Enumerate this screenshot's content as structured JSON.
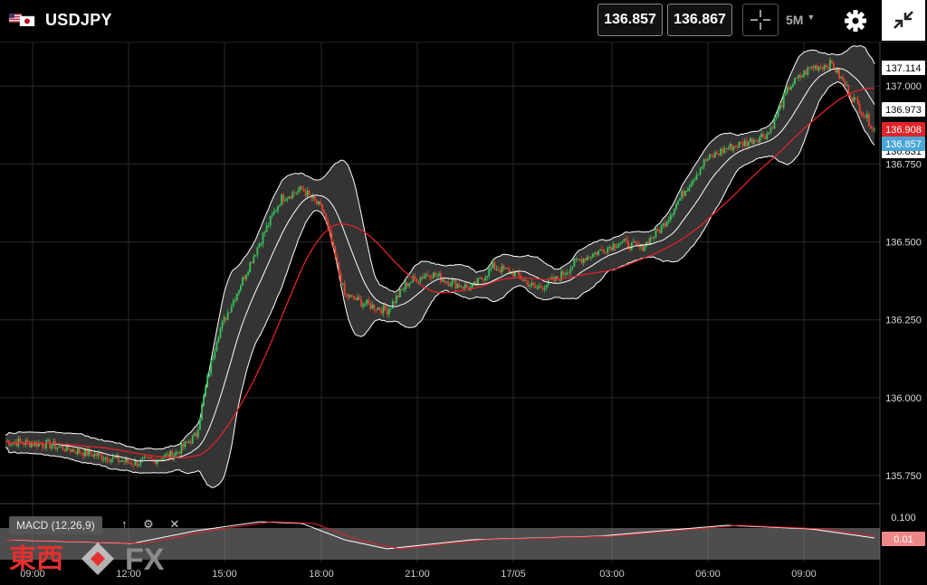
{
  "header": {
    "symbol": "USDJPY",
    "bid": "136.857",
    "ask": "136.867",
    "timeframe": "5M",
    "icons": [
      "us-jp-flags-icon",
      "crosshair-icon",
      "gear-icon",
      "collapse-icon"
    ]
  },
  "indicator": {
    "label": "MACD (12,26,9)",
    "icons": [
      "arrow-up-icon",
      "gear-icon",
      "close-icon"
    ]
  },
  "logo": {
    "text_cjk": "東西",
    "text_fx": "FX"
  },
  "price_tags": {
    "upper_band": "137.114",
    "middle_band": "136.973",
    "ma": "136.908",
    "last": "136.857",
    "lower_band": "136.831",
    "macd": "0.01"
  },
  "colors": {
    "candle_up": "#37c25a",
    "candle_down": "#e5452f",
    "ma": "#e0232a",
    "band": "#ffffff",
    "last": "#4aa6d6"
  },
  "chart_data": {
    "type": "candlestick",
    "title": "",
    "x_ticks": [
      "09:00",
      "12:00",
      "15:00",
      "18:00",
      "21:00",
      "17/05",
      "03:00",
      "06:00",
      "09:00"
    ],
    "y_ticks": [
      "137.000",
      "136.750",
      "136.500",
      "136.250",
      "136.000",
      "135.750"
    ],
    "ylim": [
      135.66,
      137.14
    ],
    "macd_ticks": [
      "0.100"
    ],
    "close_path": [
      [
        0,
        135.86
      ],
      [
        2,
        135.85
      ],
      [
        4,
        135.82
      ],
      [
        6,
        135.79
      ],
      [
        7,
        135.8
      ],
      [
        8,
        135.82
      ],
      [
        9,
        135.88
      ],
      [
        9.5,
        136.05
      ],
      [
        10,
        136.2
      ],
      [
        11,
        136.35
      ],
      [
        12,
        136.5
      ],
      [
        13,
        136.64
      ],
      [
        14,
        136.67
      ],
      [
        15,
        136.6
      ],
      [
        16,
        136.33
      ],
      [
        17,
        136.3
      ],
      [
        18,
        136.28
      ],
      [
        19,
        136.37
      ],
      [
        20,
        136.4
      ],
      [
        21,
        136.37
      ],
      [
        22,
        136.35
      ],
      [
        23,
        136.42
      ],
      [
        24,
        136.4
      ],
      [
        25,
        136.35
      ],
      [
        26,
        136.38
      ],
      [
        27,
        136.44
      ],
      [
        28,
        136.47
      ],
      [
        29,
        136.5
      ],
      [
        30,
        136.48
      ],
      [
        31,
        136.55
      ],
      [
        32,
        136.66
      ],
      [
        33,
        136.76
      ],
      [
        34,
        136.8
      ],
      [
        35,
        136.82
      ],
      [
        36,
        136.85
      ],
      [
        37,
        137.0
      ],
      [
        38,
        137.06
      ],
      [
        39,
        137.07
      ],
      [
        40,
        136.96
      ],
      [
        41,
        136.86
      ]
    ],
    "macd_line": [
      [
        0,
        0.0
      ],
      [
        6,
        -0.02
      ],
      [
        9,
        0.05
      ],
      [
        12,
        0.1
      ],
      [
        14,
        0.09
      ],
      [
        16,
        0.0
      ],
      [
        18,
        -0.05
      ],
      [
        22,
        0.0
      ],
      [
        28,
        0.02
      ],
      [
        34,
        0.08
      ],
      [
        38,
        0.06
      ],
      [
        41,
        0.01
      ]
    ],
    "bollinger": {
      "period": 20,
      "mult": 2
    },
    "ma_period": 55
  }
}
